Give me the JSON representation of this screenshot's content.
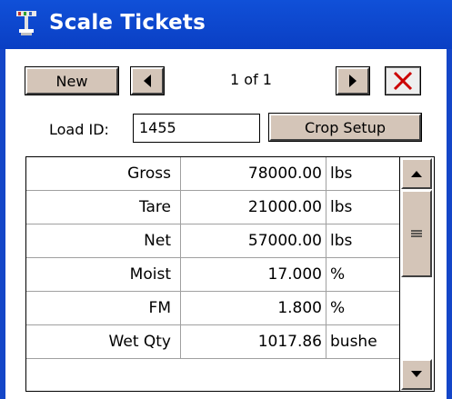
{
  "window": {
    "title": "Scale Tickets",
    "icon": "scale-app-icon"
  },
  "toolbar": {
    "new_label": "New",
    "prev_icon": "triangle-left-icon",
    "next_icon": "triangle-right-icon",
    "counter": "1 of 1",
    "delete_icon": "red-x-icon"
  },
  "load": {
    "label": "Load ID:",
    "value": "1455",
    "crop_setup_label": "Crop Setup"
  },
  "grid": {
    "rows": [
      {
        "label": "Gross",
        "value": "78000.00",
        "unit": "lbs"
      },
      {
        "label": "Tare",
        "value": "21000.00",
        "unit": "lbs"
      },
      {
        "label": "Net",
        "value": "57000.00",
        "unit": "lbs"
      },
      {
        "label": "Moist",
        "value": "17.000",
        "unit": "%"
      },
      {
        "label": "FM",
        "value": "1.800",
        "unit": "%"
      },
      {
        "label": "Wet Qty",
        "value": "1017.86",
        "unit": "bushe"
      }
    ]
  },
  "colors": {
    "titlebar": "#0a3fc4",
    "button": "#d4c5b8",
    "delete": "#cc0000"
  }
}
